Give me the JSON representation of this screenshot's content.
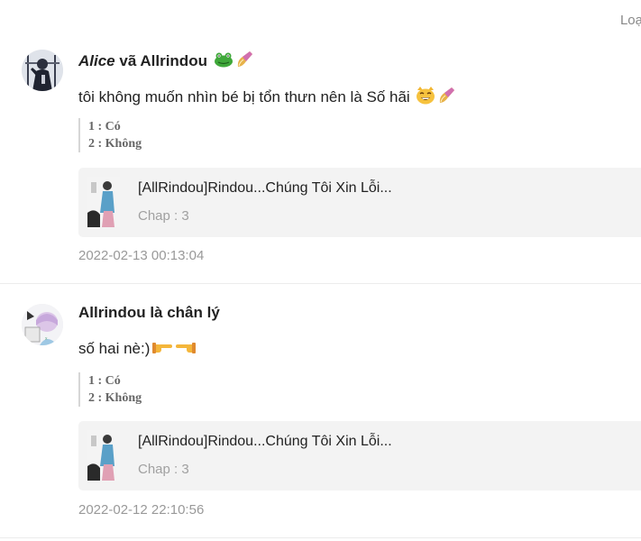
{
  "header": {
    "right_link": "Loạ"
  },
  "comments": [
    {
      "author_italic": "Alice",
      "author_rest": " vã Allrindou",
      "author_emojis": [
        "frog-icon",
        "nail-polish-icon"
      ],
      "text": "tôi không muốn nhìn bé bị tổn thưn nên là Số hãi",
      "text_emojis": [
        "grinning-cat-icon",
        "nail-polish-icon"
      ],
      "poll": [
        "1 : Có",
        "2 : Không"
      ],
      "card": {
        "title": "[AllRindou]Rindou...Chúng Tôi Xin Lỗi...",
        "chap": "Chap : 3"
      },
      "timestamp": "2022-02-13 00:13:04"
    },
    {
      "author_italic": "",
      "author_rest": "Allrindou là chân lý",
      "author_emojis": [],
      "text": "số hai nè:)",
      "text_emojis": [
        "pointing-right-icon",
        "pointing-left-icon"
      ],
      "poll": [
        "1 : Có",
        "2 : Không"
      ],
      "card": {
        "title": "[AllRindou]Rindou...Chúng Tôi Xin Lỗi...",
        "chap": "Chap : 3"
      },
      "timestamp": "2022-02-12 22:10:56"
    }
  ]
}
